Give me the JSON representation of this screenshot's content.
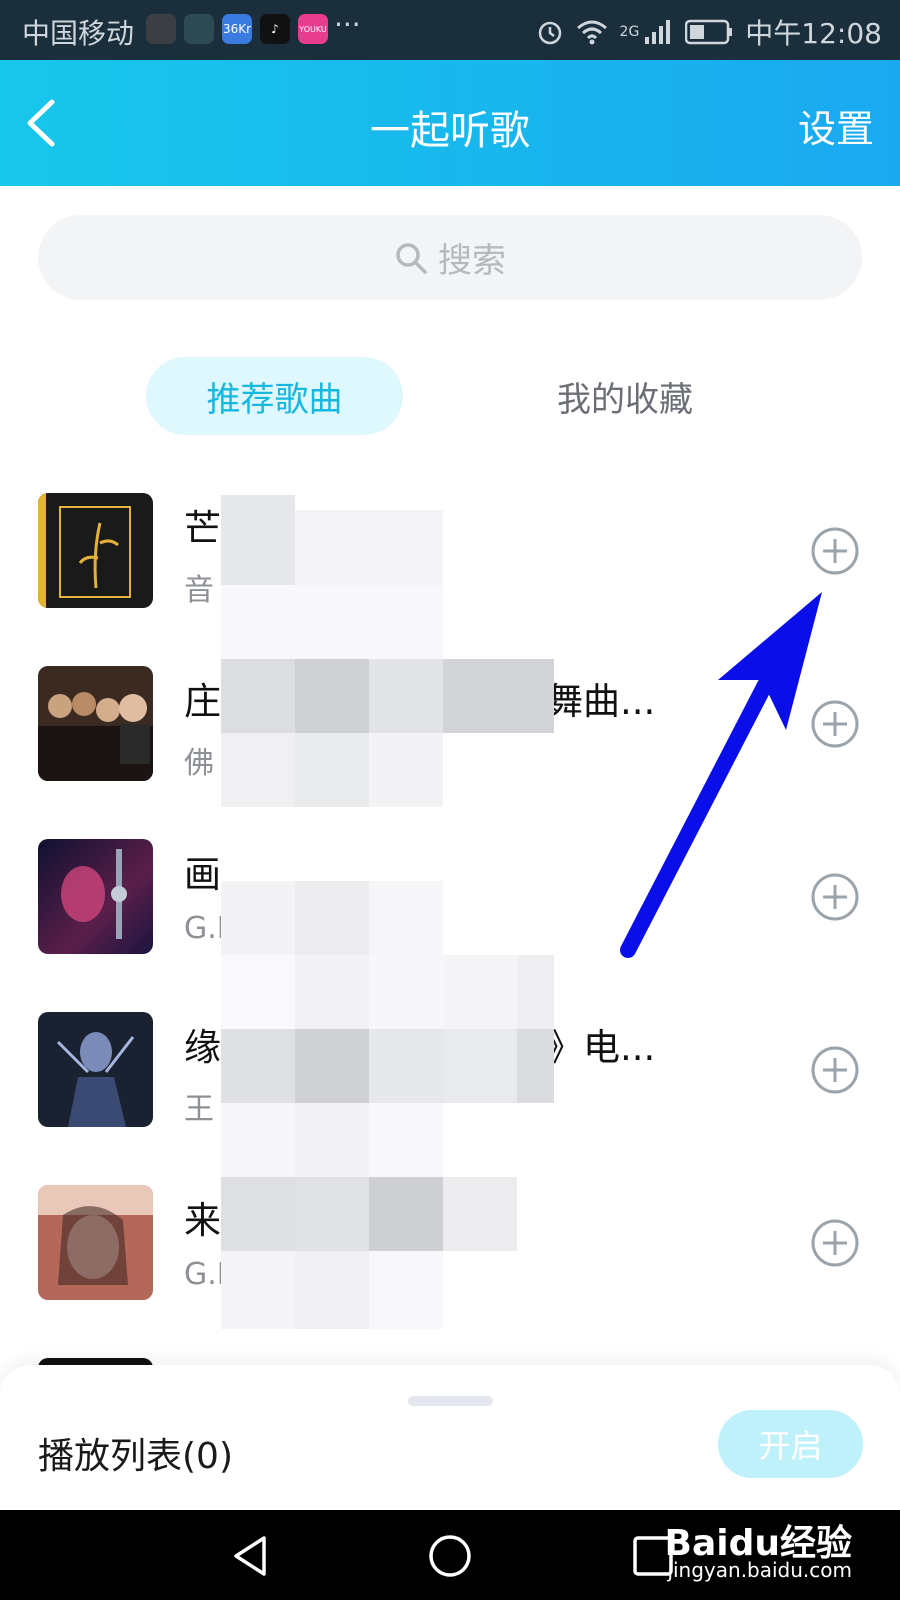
{
  "status_bar": {
    "carrier": "中国移动",
    "app_icons": [
      {
        "name": "app-icon-1",
        "label": "",
        "color": "#3b3f44"
      },
      {
        "name": "app-icon-2",
        "label": "",
        "color": "#2d4a55"
      },
      {
        "name": "36kr-icon",
        "label": "36Kr",
        "color": "#3a7be0"
      },
      {
        "name": "tiktok-icon",
        "label": "♪",
        "color": "#111111"
      },
      {
        "name": "youku-icon",
        "label": "YOUKU",
        "color": "#e83c8f"
      }
    ],
    "more": "···",
    "network": "2G",
    "time": "中午12:08"
  },
  "header": {
    "title": "一起听歌",
    "settings_label": "设置"
  },
  "search": {
    "placeholder": "搜索"
  },
  "tabs": [
    {
      "label": "推荐歌曲",
      "active": true
    },
    {
      "label": "我的收藏",
      "active": false
    }
  ],
  "songs": [
    {
      "title": "芒",
      "subtitle": "音",
      "cover_color": "#1a1a1a",
      "accent": "#e2b23a"
    },
    {
      "title": "庄",
      "title_tail": "舞曲...",
      "subtitle": "佛",
      "cover_color": "#3a2a22",
      "accent": "#c9a27e"
    },
    {
      "title": "画",
      "subtitle": "G.I",
      "cover_color": "#1b1440",
      "accent": "#d0457a"
    },
    {
      "title": "缘",
      "title_tail": "》电...",
      "subtitle": "王",
      "cover_color": "#1a2130",
      "accent": "#5a6fa3"
    },
    {
      "title": "来",
      "subtitle": "G.I",
      "cover_color": "#b3685a",
      "accent": "#f0c6b5"
    }
  ],
  "bottom_panel": {
    "playlist_label": "播放列表(0)",
    "open_button": "开启"
  },
  "watermark": {
    "text": "Baidu经验",
    "url": "jingyan.baidu.com"
  },
  "colors": {
    "accent": "#16b8e0",
    "header_gradient_start": "#17c7ea",
    "header_gradient_end": "#1aa9f0",
    "arrow": "#0a0ee8"
  }
}
